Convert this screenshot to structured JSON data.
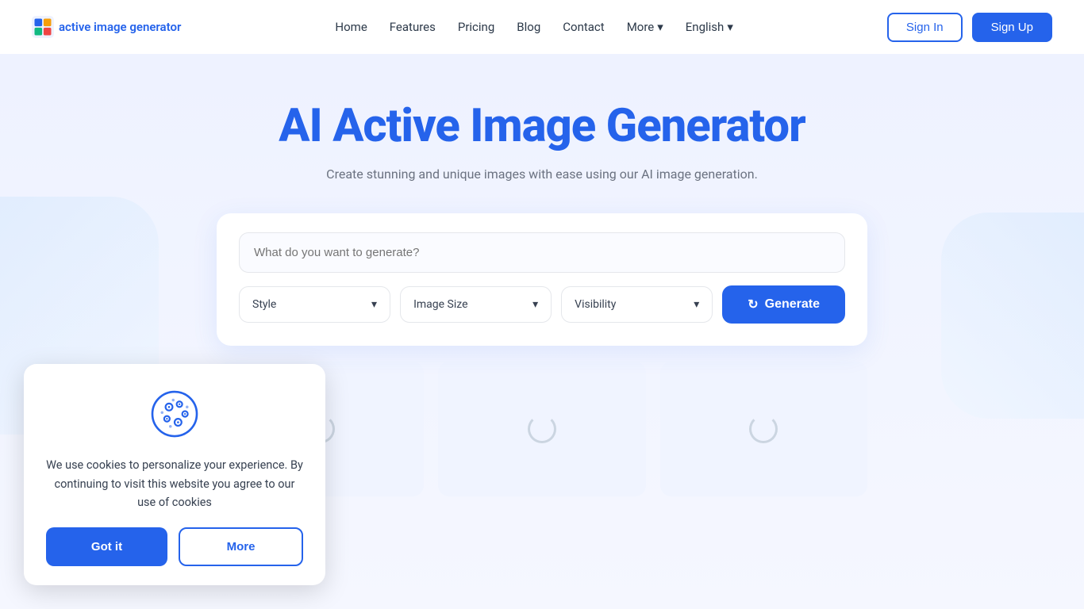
{
  "brand": {
    "logo_text": "active image generator"
  },
  "navbar": {
    "links": [
      {
        "label": "Home",
        "id": "home"
      },
      {
        "label": "Features",
        "id": "features"
      },
      {
        "label": "Pricing",
        "id": "pricing"
      },
      {
        "label": "Blog",
        "id": "blog"
      },
      {
        "label": "Contact",
        "id": "contact"
      },
      {
        "label": "More",
        "id": "more",
        "has_chevron": true
      },
      {
        "label": "English",
        "id": "english",
        "has_chevron": true
      }
    ],
    "signin_label": "Sign In",
    "signup_label": "Sign Up"
  },
  "hero": {
    "title": "AI Active Image Generator",
    "subtitle": "Create stunning and unique images with ease using our AI image generation."
  },
  "generator": {
    "prompt_placeholder": "What do you want to generate?",
    "style_dropdown": "Style",
    "image_size_dropdown": "Image Size",
    "visibility_dropdown": "Visibility",
    "generate_label": "Generate"
  },
  "cookie": {
    "text": "We use cookies to personalize your experience. By continuing to visit this website you agree to our use of cookies",
    "got_it_label": "Got it",
    "more_label": "More"
  }
}
